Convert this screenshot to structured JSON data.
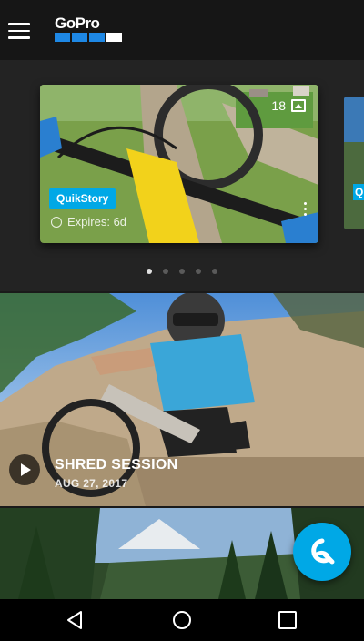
{
  "app": {
    "logo_text": "GoPro",
    "accent_color": "#00a8e6",
    "logo_blue": "#1e88e5"
  },
  "topbar": {
    "menu_icon": "hamburger-menu-icon"
  },
  "carousel": {
    "active_card": {
      "media_count": "18",
      "media_icon": "photo-icon",
      "badge": "QuikStory",
      "expire_text": "Expires: 6d",
      "expire_icon": "clock-icon"
    },
    "peek_card": {
      "badge": "Q"
    },
    "pages_total": 5,
    "page_current": 1
  },
  "featured": {
    "title": "SHRED SESSION",
    "date": "AUG 27, 2017",
    "play_icon": "play-icon"
  },
  "fab": {
    "icon": "quik-icon"
  },
  "navbar": {
    "back_icon": "back-icon",
    "home_icon": "home-icon",
    "recents_icon": "recents-icon"
  }
}
